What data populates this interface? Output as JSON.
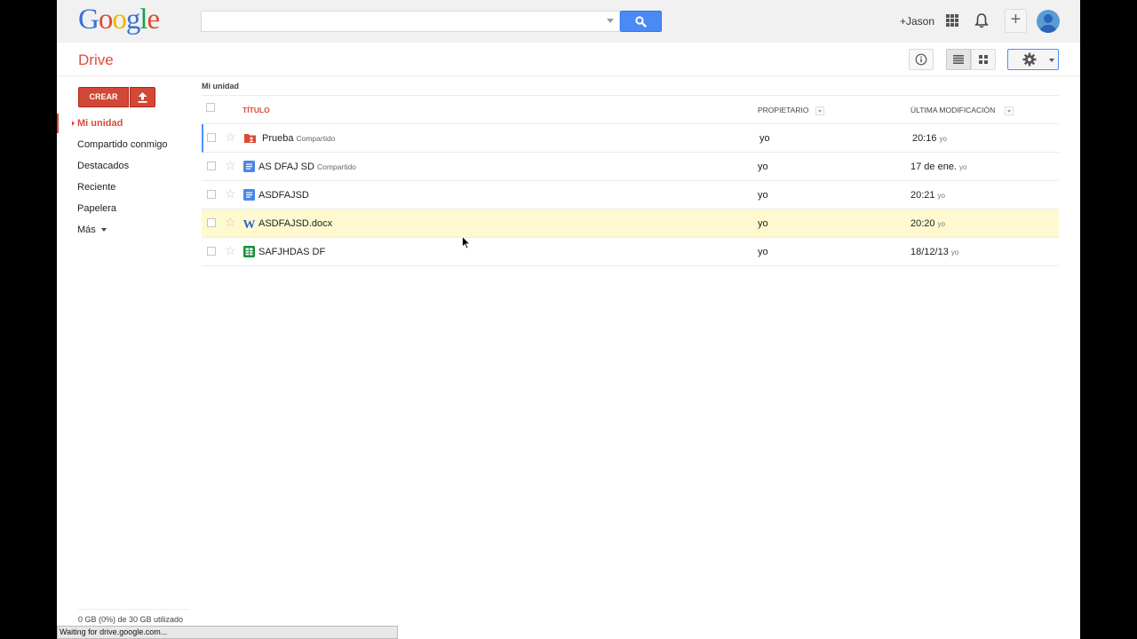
{
  "header": {
    "logo_letters": [
      {
        "ch": "G",
        "color": "#3c72d6"
      },
      {
        "ch": "o",
        "color": "#dd4b39"
      },
      {
        "ch": "o",
        "color": "#f4b400"
      },
      {
        "ch": "g",
        "color": "#3c72d6"
      },
      {
        "ch": "l",
        "color": "#1e9e4b"
      },
      {
        "ch": "e",
        "color": "#dd4b39"
      }
    ],
    "search_value": "",
    "user_link": "+Jason",
    "plus_label": "+"
  },
  "subbar": {
    "title": "Drive"
  },
  "sidebar": {
    "create_label": "CREAR",
    "items": [
      {
        "label": "Mi unidad",
        "active": true
      },
      {
        "label": "Compartido conmigo",
        "active": false
      },
      {
        "label": "Destacados",
        "active": false
      },
      {
        "label": "Reciente",
        "active": false
      },
      {
        "label": "Papelera",
        "active": false
      },
      {
        "label": "Más",
        "active": false
      }
    ],
    "storage": "0 GB (0%) de 30 GB utilizado"
  },
  "list": {
    "breadcrumb": "Mi unidad",
    "columns": {
      "title": "TÍTULO",
      "owner": "PROPIETARIO",
      "modified": "ÚLTIMA MODIFICACIÓN"
    },
    "rows": [
      {
        "name": "Prueba",
        "tag": "Compartido",
        "icon": "shared-folder-icon",
        "owner": "yo",
        "modified": "20:16",
        "modified_by": "yo"
      },
      {
        "name": "AS DFAJ SD",
        "tag": "Compartido",
        "icon": "document-icon",
        "owner": "yo",
        "modified": "17 de ene.",
        "modified_by": "yo"
      },
      {
        "name": "ASDFAJSD",
        "tag": "",
        "icon": "document-icon",
        "owner": "yo",
        "modified": "20:21",
        "modified_by": "yo"
      },
      {
        "name": "ASDFAJSD.docx",
        "tag": "",
        "icon": "word-icon",
        "owner": "yo",
        "modified": "20:20",
        "modified_by": "yo"
      },
      {
        "name": "SAFJHDAS DF",
        "tag": "",
        "icon": "spreadsheet-icon",
        "owner": "yo",
        "modified": "18/12/13",
        "modified_by": "yo"
      }
    ]
  },
  "status_bar": "Waiting for drive.google.com...",
  "colors": {
    "accent_red": "#dd4b39",
    "search_blue": "#4a8af4",
    "highlight_row": "#fff9cf"
  }
}
